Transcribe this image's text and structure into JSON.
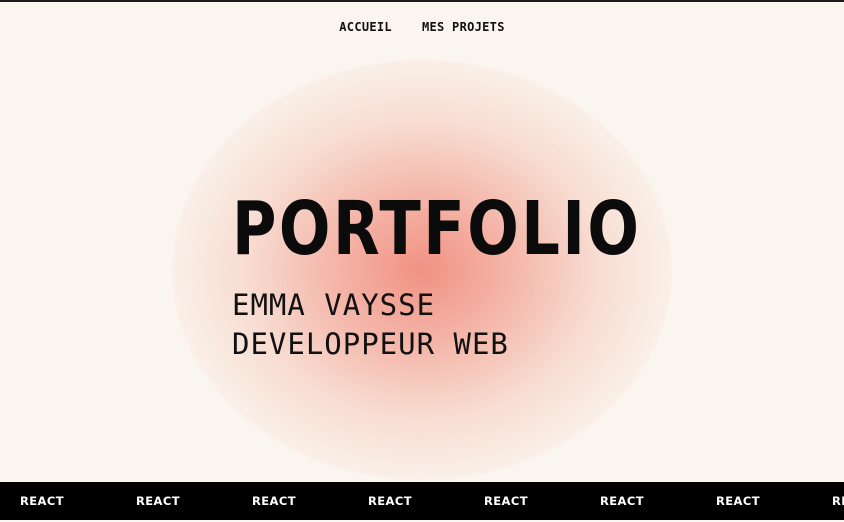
{
  "nav": {
    "items": [
      {
        "label": "ACCUEIL"
      },
      {
        "label": "MES PROJETS"
      }
    ]
  },
  "hero": {
    "title": "PORTFOLIO",
    "name": "EMMA VAYSSE",
    "role": "DEVELOPPEUR WEB"
  },
  "ticker": {
    "items": [
      "REACT",
      "REACT",
      "REACT",
      "REACT",
      "REACT",
      "REACT",
      "REACT",
      "REACT"
    ]
  },
  "colors": {
    "background": "#faf6ef",
    "glow": "#f08c7d",
    "text": "#111111",
    "ticker_bg": "#000000",
    "ticker_text": "#ffffff"
  }
}
